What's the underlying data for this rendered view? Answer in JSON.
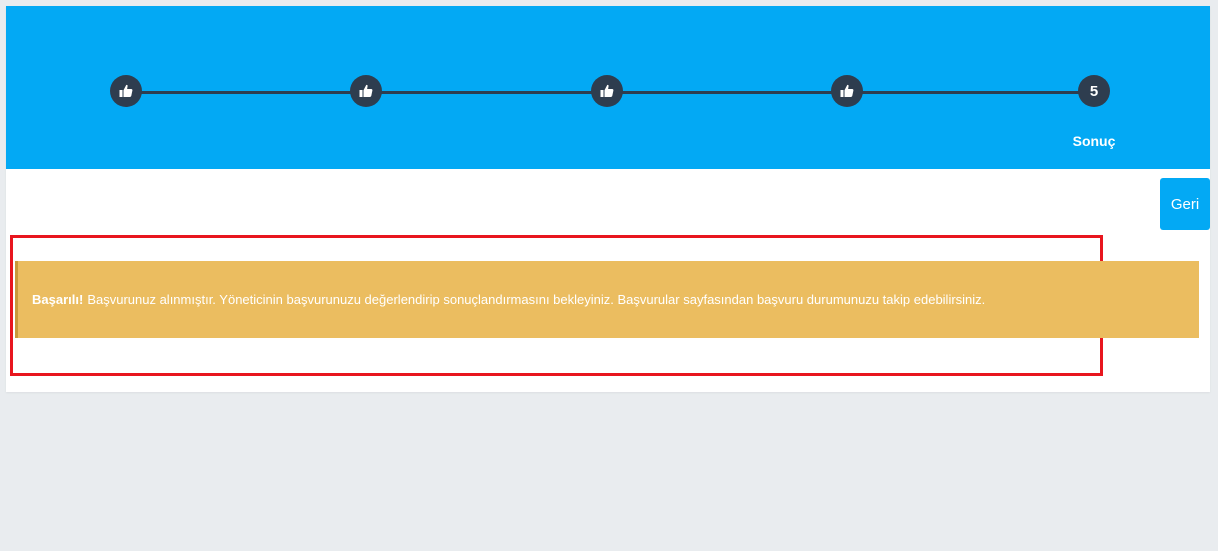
{
  "colors": {
    "header_bg": "#03a9f4",
    "step_circle": "#2e3d4f",
    "alert_bg": "#ebbd60",
    "button_bg": "#03a9f4",
    "highlight_border": "#e8161e"
  },
  "wizard": {
    "steps": [
      {
        "icon": "thumbs-up-icon",
        "state": "completed"
      },
      {
        "icon": "thumbs-up-icon",
        "state": "completed"
      },
      {
        "icon": "thumbs-up-icon",
        "state": "completed"
      },
      {
        "icon": "thumbs-up-icon",
        "state": "completed"
      },
      {
        "number": "5",
        "label": "Sonuç",
        "state": "active"
      }
    ]
  },
  "actions": {
    "back_label": "Geri"
  },
  "alert": {
    "title": "Başarılı!",
    "message": "Başvurunuz alınmıştır. Yöneticinin başvurunuzu değerlendirip sonuçlandırmasını bekleyiniz. Başvurular sayfasından başvuru durumunuzu takip edebilirsiniz."
  }
}
